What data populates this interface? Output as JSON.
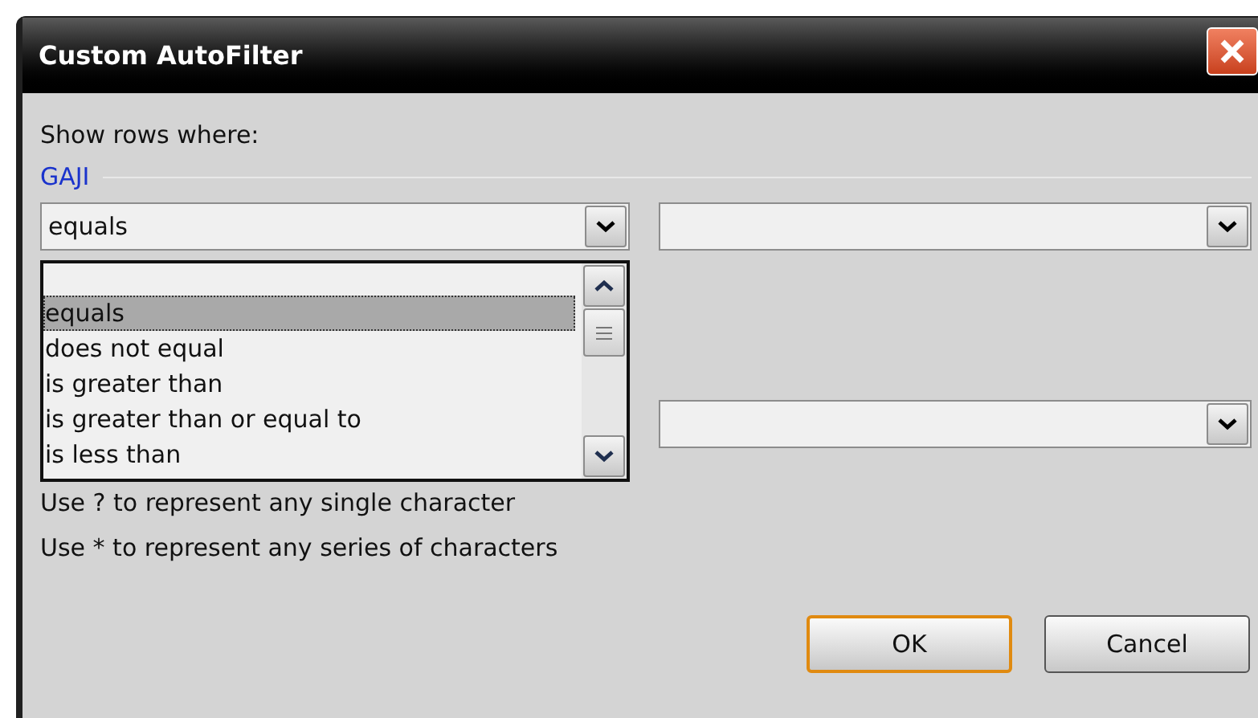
{
  "window": {
    "title": "Custom AutoFilter"
  },
  "intro": "Show rows where:",
  "field_name": "GAJI",
  "operator_combo": {
    "value": "equals",
    "expanded": true
  },
  "operator_options": [
    {
      "label": "equals",
      "selected": true
    },
    {
      "label": "does not equal",
      "selected": false
    },
    {
      "label": "is greater than",
      "selected": false
    },
    {
      "label": "is greater than or equal to",
      "selected": false
    },
    {
      "label": "is less than",
      "selected": false
    }
  ],
  "hints": [
    "Use ? to represent any single character",
    "Use * to represent any series of characters"
  ],
  "buttons": [
    {
      "label": "OK",
      "default": true
    },
    {
      "label": "Cancel",
      "default": false
    }
  ]
}
